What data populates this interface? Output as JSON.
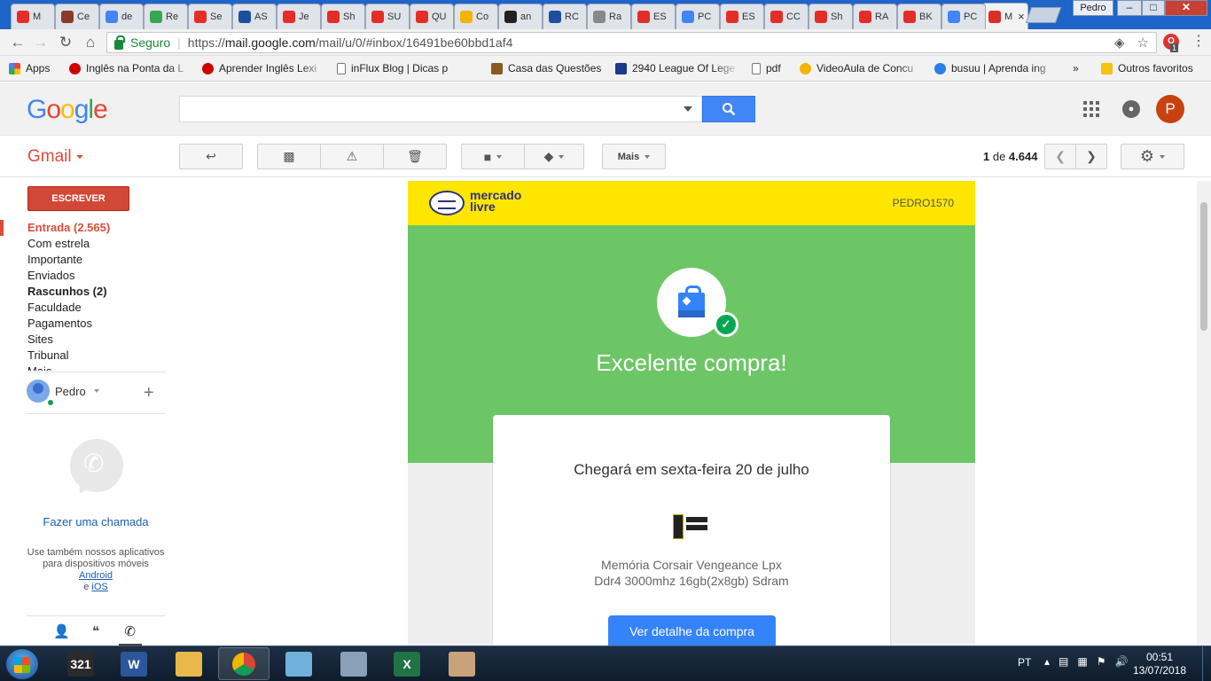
{
  "browser": {
    "tabs": [
      {
        "label": "M",
        "icon": "youtube-icon",
        "color": "#e52d27"
      },
      {
        "label": "Ce",
        "icon": "bug-icon",
        "color": "#8a3a2a"
      },
      {
        "label": "de",
        "icon": "google-icon",
        "color": "#4285f4"
      },
      {
        "label": "Re",
        "icon": "maps-icon",
        "color": "#34a853"
      },
      {
        "label": "Se",
        "icon": "youtube-icon",
        "color": "#e52d27"
      },
      {
        "label": "AS",
        "icon": "app-icon",
        "color": "#1c4fa0"
      },
      {
        "label": "Je",
        "icon": "youtube-icon",
        "color": "#e52d27"
      },
      {
        "label": "Sh",
        "icon": "youtube-icon",
        "color": "#e52d27"
      },
      {
        "label": "SU",
        "icon": "youtube-icon",
        "color": "#e52d27"
      },
      {
        "label": "QU",
        "icon": "youtube-icon",
        "color": "#e52d27"
      },
      {
        "label": "Co",
        "icon": "puzzle-icon",
        "color": "#f4b400"
      },
      {
        "label": "an",
        "icon": "app-icon",
        "color": "#222222"
      },
      {
        "label": "RC",
        "icon": "app-icon",
        "color": "#1c4fa0"
      },
      {
        "label": "Ra",
        "icon": "page-icon",
        "color": "#888888"
      },
      {
        "label": "ES",
        "icon": "youtube-icon",
        "color": "#e52d27"
      },
      {
        "label": "PC",
        "icon": "loading-icon",
        "color": "#4285f4"
      },
      {
        "label": "ES",
        "icon": "youtube-icon",
        "color": "#e52d27"
      },
      {
        "label": "CC",
        "icon": "youtube-icon",
        "color": "#e52d27"
      },
      {
        "label": "Sh",
        "icon": "youtube-icon",
        "color": "#e52d27"
      },
      {
        "label": "RA",
        "icon": "youtube-icon",
        "color": "#e52d27"
      },
      {
        "label": "BK",
        "icon": "youtube-icon",
        "color": "#e52d27"
      },
      {
        "label": "PC",
        "icon": "loading-icon",
        "color": "#4285f4"
      },
      {
        "label": "M",
        "icon": "gmail-icon",
        "color": "#d93025"
      }
    ],
    "window_user": "Pedro",
    "min": "–",
    "max": "□",
    "close": "✕",
    "secure_label": "Seguro",
    "url_base": "https://",
    "url_host": "mail.google.com",
    "url_path": "/mail/u/0/#inbox/16491be60bbd1af4",
    "ext_badge": "1"
  },
  "bookmarks": [
    {
      "label": "Apps",
      "icon": "apps-grid-icon",
      "color": "#1a73e8"
    },
    {
      "label": "Inglês na Ponta da L",
      "icon": "pin-icon",
      "color": "#d00000"
    },
    {
      "label": "Aprender Inglês Lexi",
      "icon": "pin-icon",
      "color": "#d00000"
    },
    {
      "label": "inFlux Blog | Dicas p",
      "icon": "page-icon",
      "color": "#777777"
    },
    {
      "label": "Casa das Questões",
      "icon": "house-icon",
      "color": "#8a5a20"
    },
    {
      "label": "2940 League Of Lege",
      "icon": "wolf-icon",
      "color": "#1a3a8a"
    },
    {
      "label": "pdf",
      "icon": "page-icon",
      "color": "#777777"
    },
    {
      "label": "VideoAula de Concu",
      "icon": "book-icon",
      "color": "#f4b400"
    },
    {
      "label": "busuu | Aprenda ing",
      "icon": "busuu-icon",
      "color": "#2b7de9"
    },
    {
      "label": "»",
      "icon": "",
      "color": ""
    },
    {
      "label": "Outros favoritos",
      "icon": "folder-icon",
      "color": "#f1c40f"
    }
  ],
  "google": {
    "logo": [
      "G",
      "o",
      "o",
      "g",
      "l",
      "e"
    ],
    "logo_colors": [
      "#4285f4",
      "#ea4335",
      "#fbbc05",
      "#4285f4",
      "#34a853",
      "#ea4335"
    ],
    "avatar_letter": "P"
  },
  "gmail": {
    "label": "Gmail",
    "more_label": "Mais",
    "pager_current": "1",
    "pager_of": " de ",
    "pager_total": "4.644",
    "compose": "ESCREVER",
    "nav": [
      {
        "label": "Entrada (2.565)",
        "style": "active"
      },
      {
        "label": "Com estrela",
        "style": ""
      },
      {
        "label": "Importante",
        "style": ""
      },
      {
        "label": "Enviados",
        "style": ""
      },
      {
        "label": "Rascunhos (2)",
        "style": "bold"
      },
      {
        "label": "Faculdade",
        "style": ""
      },
      {
        "label": "Pagamentos",
        "style": ""
      },
      {
        "label": "Sites",
        "style": ""
      },
      {
        "label": "Tribunal",
        "style": ""
      },
      {
        "label": "Mais",
        "style": ""
      }
    ],
    "hangouts_user": "Pedro",
    "call_link": "Fazer uma chamada",
    "apps_text": "Use também nossos aplicativos para dispositivos móveis",
    "android": "Android",
    "and": " e ",
    "ios": "iOS"
  },
  "email": {
    "brand_line1": "mercado",
    "brand_line2": "livre",
    "username": "PEDRO1570",
    "headline": "Excelente compra!",
    "arrival": "Chegará em sexta-feira 20 de julho",
    "product_line1": "Memória Corsair Vengeance Lpx",
    "product_line2": "Ddr4 3000mhz 16gb(2x8gb) Sdram",
    "button": "Ver detalhe da compra",
    "colors": {
      "header": "#ffe600",
      "green": "#6cc666",
      "button": "#3483fa"
    }
  },
  "taskbar": {
    "apps": [
      {
        "name": "media-player",
        "label": "321",
        "color": "#2a2a2a"
      },
      {
        "name": "word",
        "label": "W",
        "color": "#2b579a"
      },
      {
        "name": "file-explorer",
        "label": "",
        "color": "#e8b94a"
      },
      {
        "name": "chrome",
        "label": "",
        "color": "#dd4b39"
      },
      {
        "name": "notes",
        "label": "",
        "color": "#6fb1d8"
      },
      {
        "name": "calculator",
        "label": "",
        "color": "#8aa0b8"
      },
      {
        "name": "excel",
        "label": "X",
        "color": "#217346"
      },
      {
        "name": "paint",
        "label": "",
        "color": "#c9a27a"
      }
    ],
    "lang": "PT",
    "time": "00:51",
    "date": "13/07/2018"
  }
}
